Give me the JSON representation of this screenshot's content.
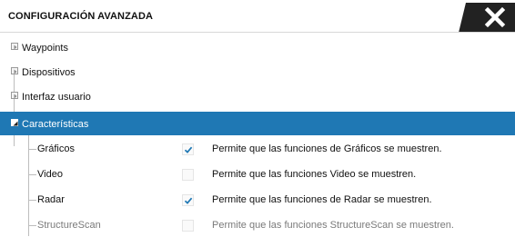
{
  "window": {
    "title": "CONFIGURACIÓN AVANZADA"
  },
  "tree": {
    "groups": [
      {
        "label": "Waypoints",
        "expanded": false
      },
      {
        "label": "Dispositivos",
        "expanded": false
      },
      {
        "label": "Interfaz usuario",
        "expanded": false
      },
      {
        "label": "Características",
        "expanded": true,
        "selected": true
      }
    ],
    "features": [
      {
        "label": "Gráficos",
        "checked": true,
        "description": "Permite que las funciones de Gráficos se muestren."
      },
      {
        "label": "Video",
        "checked": false,
        "description": "Permite que las funciones Video se muestren."
      },
      {
        "label": "Radar",
        "checked": true,
        "description": "Permite que las funciones de Radar se muestren."
      },
      {
        "label": "StructureScan",
        "checked": false,
        "description": "Permite que las funciones StructureScan se muestren."
      }
    ]
  },
  "colors": {
    "selection": "#1f78b4",
    "check_accent": "#1f78b4",
    "close_tab": "#222222"
  },
  "icons": {
    "close": "close-icon",
    "expand": "expand-arrow-icon",
    "collapse": "collapse-arrow-icon",
    "check": "checkmark-icon"
  }
}
